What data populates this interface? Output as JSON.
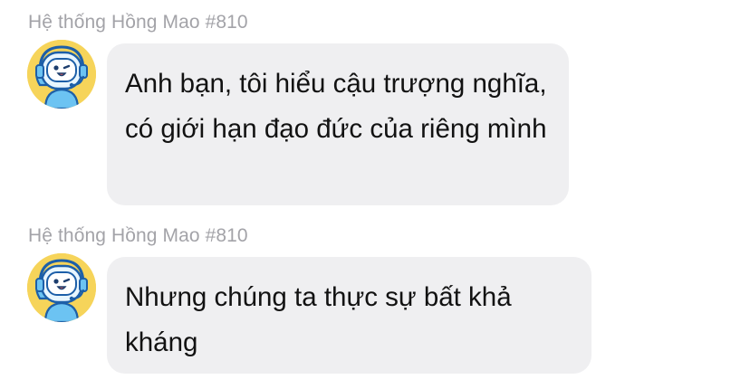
{
  "colors": {
    "background": "#ffffff",
    "bubble": "#efeff1",
    "sender_text": "#a3a3a8",
    "message_text": "#121212",
    "avatar_bg": "#f6d45a"
  },
  "messages": [
    {
      "sender": "Hệ thống Hồng Mao #810",
      "avatar_icon": "robot-headset-avatar",
      "text": "Anh bạn, tôi hiểu cậu trượng nghĩa, có giới hạn đạo đức của riêng mình"
    },
    {
      "sender": "Hệ thống Hồng Mao #810",
      "avatar_icon": "robot-headset-avatar",
      "text": "Nhưng chúng ta thực sự bất khả kháng"
    }
  ]
}
